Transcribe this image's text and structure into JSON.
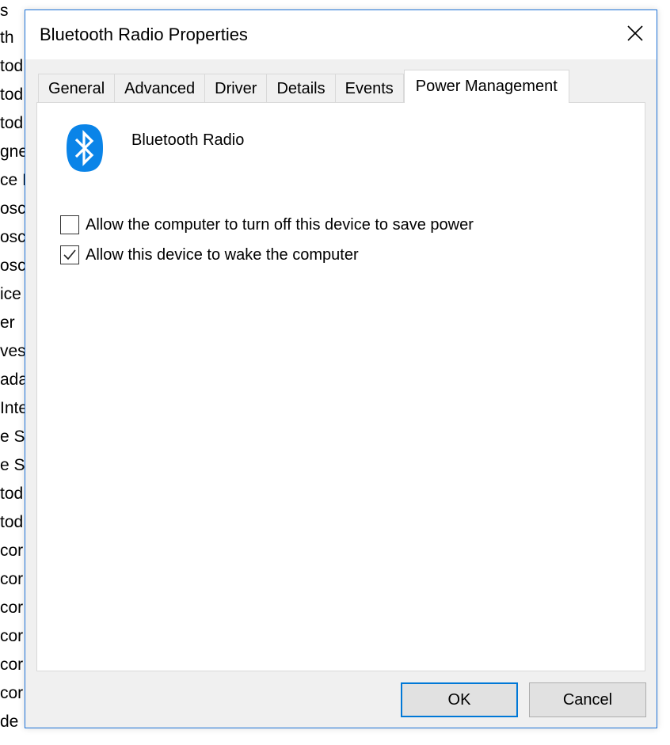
{
  "background_window": {
    "lines": [
      "s",
      "th",
      "tod",
      "tod",
      "tod",
      "gne",
      "ce I",
      "osc",
      "osc",
      "osc",
      "ice",
      "er",
      "ves",
      "ada",
      "Inte",
      "e S",
      "e S",
      "tod",
      "tod",
      "cor",
      "cor",
      "cor",
      "cor",
      "cor",
      "cor",
      " de"
    ]
  },
  "dialog": {
    "title": "Bluetooth Radio Properties",
    "close_glyph": "✕",
    "tabs": [
      {
        "label": "General",
        "active": false
      },
      {
        "label": "Advanced",
        "active": false
      },
      {
        "label": "Driver",
        "active": false
      },
      {
        "label": "Details",
        "active": false
      },
      {
        "label": "Events",
        "active": false
      },
      {
        "label": "Power Management",
        "active": true
      }
    ],
    "device": {
      "name": "Bluetooth Radio",
      "icon": "bluetooth-icon",
      "icon_color": "#0a84e8"
    },
    "options": [
      {
        "label": "Allow the computer to turn off this device to save power",
        "checked": false
      },
      {
        "label": "Allow this device to wake the computer",
        "checked": true
      }
    ],
    "buttons": {
      "ok_label": "OK",
      "cancel_label": "Cancel"
    },
    "accent_color": "#0078d7"
  }
}
